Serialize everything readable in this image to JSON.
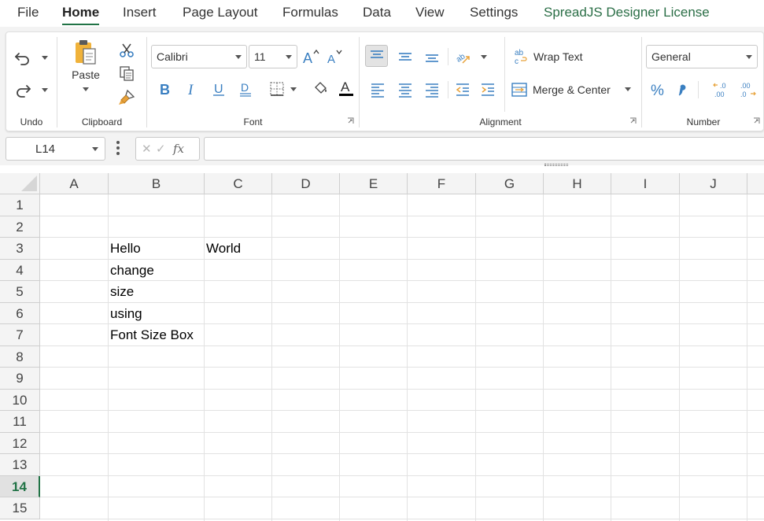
{
  "menu": {
    "tabs": [
      "File",
      "Home",
      "Insert",
      "Page Layout",
      "Formulas",
      "Data",
      "View",
      "Settings",
      "SpreadJS Designer License"
    ],
    "active": "Home"
  },
  "ribbon": {
    "undo_group": {
      "label": "Undo"
    },
    "clipboard_group": {
      "label": "Clipboard",
      "paste_label": "Paste"
    },
    "font_group": {
      "label": "Font",
      "font_name": "Calibri",
      "font_size": "11"
    },
    "alignment_group": {
      "label": "Alignment",
      "wrap_text_label": "Wrap Text",
      "merge_center_label": "Merge & Center"
    },
    "number_group": {
      "label": "Number",
      "format": "General"
    }
  },
  "formula_bar": {
    "name_box": "L14",
    "fx_label": "fx",
    "formula": ""
  },
  "sheet": {
    "columns": [
      "A",
      "B",
      "C",
      "D",
      "E",
      "F",
      "G",
      "H",
      "I",
      "J"
    ],
    "rows": [
      "1",
      "2",
      "3",
      "4",
      "5",
      "6",
      "7",
      "8",
      "9",
      "10",
      "11",
      "12",
      "13",
      "14",
      "15"
    ],
    "active_row": "14",
    "cells": {
      "B3": "Hello",
      "C3": "World",
      "B4": "change",
      "B5": "size",
      "B6": "using",
      "B7": "Font Size Box"
    }
  },
  "colors": {
    "accent": "#217346",
    "license_tab": "#2a6e46",
    "font_color_bar": "#000000",
    "icon_blue": "#3a7fc1",
    "icon_orange": "#e8a23a"
  }
}
